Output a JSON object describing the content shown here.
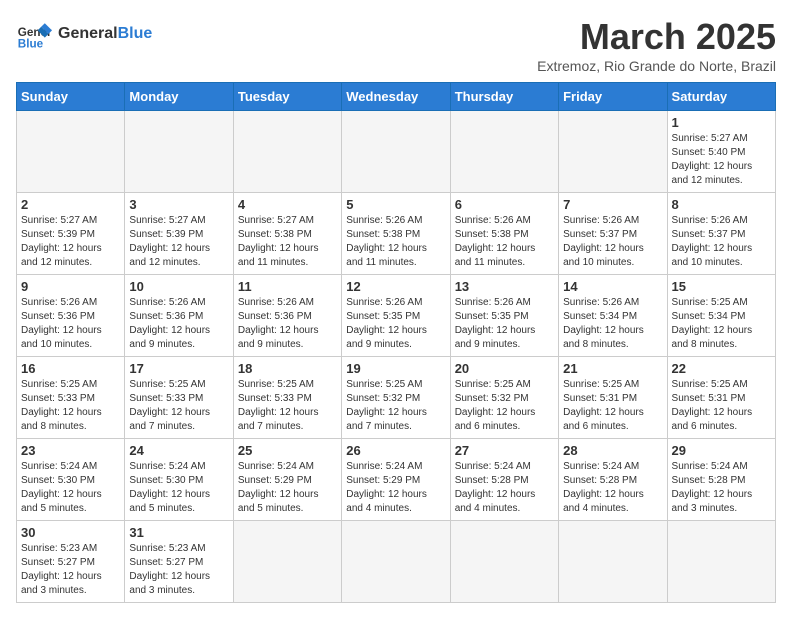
{
  "header": {
    "logo_general": "General",
    "logo_blue": "Blue",
    "title": "March 2025",
    "subtitle": "Extremoz, Rio Grande do Norte, Brazil"
  },
  "weekdays": [
    "Sunday",
    "Monday",
    "Tuesday",
    "Wednesday",
    "Thursday",
    "Friday",
    "Saturday"
  ],
  "weeks": [
    [
      {
        "day": "",
        "info": ""
      },
      {
        "day": "",
        "info": ""
      },
      {
        "day": "",
        "info": ""
      },
      {
        "day": "",
        "info": ""
      },
      {
        "day": "",
        "info": ""
      },
      {
        "day": "",
        "info": ""
      },
      {
        "day": "1",
        "info": "Sunrise: 5:27 AM\nSunset: 5:40 PM\nDaylight: 12 hours and 12 minutes."
      }
    ],
    [
      {
        "day": "2",
        "info": "Sunrise: 5:27 AM\nSunset: 5:39 PM\nDaylight: 12 hours and 12 minutes."
      },
      {
        "day": "3",
        "info": "Sunrise: 5:27 AM\nSunset: 5:39 PM\nDaylight: 12 hours and 12 minutes."
      },
      {
        "day": "4",
        "info": "Sunrise: 5:27 AM\nSunset: 5:38 PM\nDaylight: 12 hours and 11 minutes."
      },
      {
        "day": "5",
        "info": "Sunrise: 5:26 AM\nSunset: 5:38 PM\nDaylight: 12 hours and 11 minutes."
      },
      {
        "day": "6",
        "info": "Sunrise: 5:26 AM\nSunset: 5:38 PM\nDaylight: 12 hours and 11 minutes."
      },
      {
        "day": "7",
        "info": "Sunrise: 5:26 AM\nSunset: 5:37 PM\nDaylight: 12 hours and 10 minutes."
      },
      {
        "day": "8",
        "info": "Sunrise: 5:26 AM\nSunset: 5:37 PM\nDaylight: 12 hours and 10 minutes."
      }
    ],
    [
      {
        "day": "9",
        "info": "Sunrise: 5:26 AM\nSunset: 5:36 PM\nDaylight: 12 hours and 10 minutes."
      },
      {
        "day": "10",
        "info": "Sunrise: 5:26 AM\nSunset: 5:36 PM\nDaylight: 12 hours and 9 minutes."
      },
      {
        "day": "11",
        "info": "Sunrise: 5:26 AM\nSunset: 5:36 PM\nDaylight: 12 hours and 9 minutes."
      },
      {
        "day": "12",
        "info": "Sunrise: 5:26 AM\nSunset: 5:35 PM\nDaylight: 12 hours and 9 minutes."
      },
      {
        "day": "13",
        "info": "Sunrise: 5:26 AM\nSunset: 5:35 PM\nDaylight: 12 hours and 9 minutes."
      },
      {
        "day": "14",
        "info": "Sunrise: 5:26 AM\nSunset: 5:34 PM\nDaylight: 12 hours and 8 minutes."
      },
      {
        "day": "15",
        "info": "Sunrise: 5:25 AM\nSunset: 5:34 PM\nDaylight: 12 hours and 8 minutes."
      }
    ],
    [
      {
        "day": "16",
        "info": "Sunrise: 5:25 AM\nSunset: 5:33 PM\nDaylight: 12 hours and 8 minutes."
      },
      {
        "day": "17",
        "info": "Sunrise: 5:25 AM\nSunset: 5:33 PM\nDaylight: 12 hours and 7 minutes."
      },
      {
        "day": "18",
        "info": "Sunrise: 5:25 AM\nSunset: 5:33 PM\nDaylight: 12 hours and 7 minutes."
      },
      {
        "day": "19",
        "info": "Sunrise: 5:25 AM\nSunset: 5:32 PM\nDaylight: 12 hours and 7 minutes."
      },
      {
        "day": "20",
        "info": "Sunrise: 5:25 AM\nSunset: 5:32 PM\nDaylight: 12 hours and 6 minutes."
      },
      {
        "day": "21",
        "info": "Sunrise: 5:25 AM\nSunset: 5:31 PM\nDaylight: 12 hours and 6 minutes."
      },
      {
        "day": "22",
        "info": "Sunrise: 5:25 AM\nSunset: 5:31 PM\nDaylight: 12 hours and 6 minutes."
      }
    ],
    [
      {
        "day": "23",
        "info": "Sunrise: 5:24 AM\nSunset: 5:30 PM\nDaylight: 12 hours and 5 minutes."
      },
      {
        "day": "24",
        "info": "Sunrise: 5:24 AM\nSunset: 5:30 PM\nDaylight: 12 hours and 5 minutes."
      },
      {
        "day": "25",
        "info": "Sunrise: 5:24 AM\nSunset: 5:29 PM\nDaylight: 12 hours and 5 minutes."
      },
      {
        "day": "26",
        "info": "Sunrise: 5:24 AM\nSunset: 5:29 PM\nDaylight: 12 hours and 4 minutes."
      },
      {
        "day": "27",
        "info": "Sunrise: 5:24 AM\nSunset: 5:28 PM\nDaylight: 12 hours and 4 minutes."
      },
      {
        "day": "28",
        "info": "Sunrise: 5:24 AM\nSunset: 5:28 PM\nDaylight: 12 hours and 4 minutes."
      },
      {
        "day": "29",
        "info": "Sunrise: 5:24 AM\nSunset: 5:28 PM\nDaylight: 12 hours and 3 minutes."
      }
    ],
    [
      {
        "day": "30",
        "info": "Sunrise: 5:23 AM\nSunset: 5:27 PM\nDaylight: 12 hours and 3 minutes."
      },
      {
        "day": "31",
        "info": "Sunrise: 5:23 AM\nSunset: 5:27 PM\nDaylight: 12 hours and 3 minutes."
      },
      {
        "day": "",
        "info": ""
      },
      {
        "day": "",
        "info": ""
      },
      {
        "day": "",
        "info": ""
      },
      {
        "day": "",
        "info": ""
      },
      {
        "day": "",
        "info": ""
      }
    ]
  ]
}
